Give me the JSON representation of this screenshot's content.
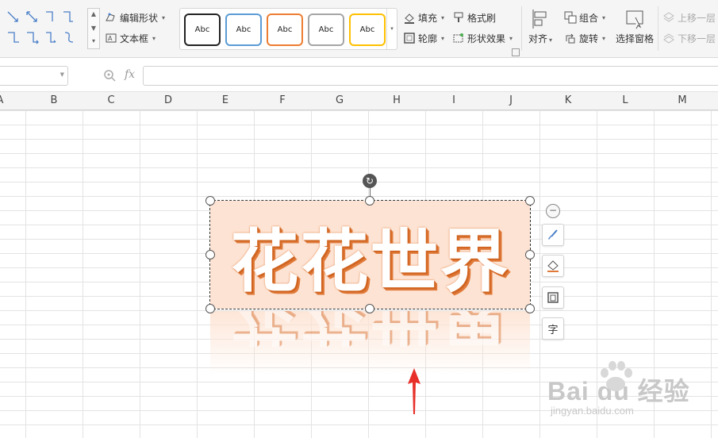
{
  "ribbon": {
    "edit_shape": "编辑形状",
    "text_box": "文本框",
    "style_gallery": [
      {
        "label": "Abc",
        "border": "#222222"
      },
      {
        "label": "Abc",
        "border": "#5b9bd5"
      },
      {
        "label": "Abc",
        "border": "#ed7d31"
      },
      {
        "label": "Abc",
        "border": "#a5a5a5"
      },
      {
        "label": "Abc",
        "border": "#ffc000"
      }
    ],
    "fill": "填充",
    "outline": "轮廓",
    "format_painter": "格式刷",
    "shape_effects": "形状效果",
    "align": "对齐",
    "group": "组合",
    "rotate": "旋转",
    "selection_pane": "选择窗格",
    "bring_forward": "上移一层",
    "send_backward": "下移一层"
  },
  "formula_bar": {
    "fx_label": "fx",
    "name_box_value": "",
    "formula_value": ""
  },
  "columns": [
    "A",
    "B",
    "C",
    "D",
    "E",
    "F",
    "G",
    "H",
    "I",
    "J",
    "K",
    "L",
    "M"
  ],
  "art_text": "花花世界",
  "side_tools": {
    "text_wrap_icon_label": "字"
  },
  "watermark": {
    "brand": "Bai du 经验",
    "url": "jingyan.baidu.com"
  },
  "colors": {
    "shape_fill": "#fde3d3",
    "text_outline": "#e07a3a",
    "arrow": "#e8302a"
  }
}
